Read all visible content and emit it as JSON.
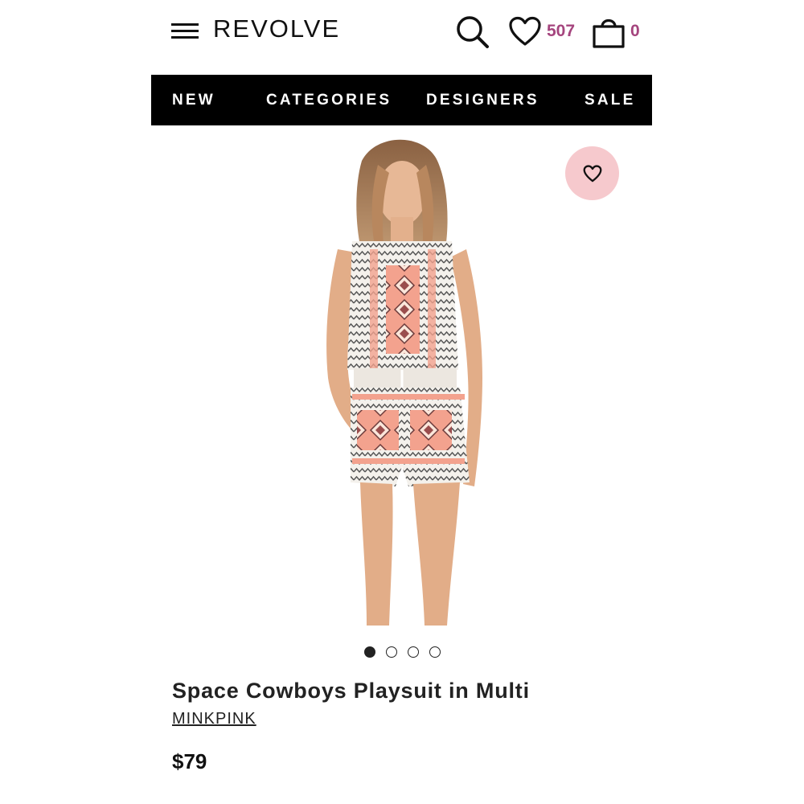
{
  "header": {
    "logo": "REVOLVE",
    "wishlist_count": "507",
    "bag_count": "0"
  },
  "nav": {
    "items": [
      "NEW",
      "CATEGORIES",
      "DESIGNERS",
      "SALE"
    ]
  },
  "product": {
    "title": "Space Cowboys Playsuit in Multi",
    "brand": "MINKPINK",
    "price": "$79",
    "image_count": 4,
    "active_image_index": 0
  },
  "colors": {
    "accent": "#a5457e",
    "nav_bg": "#000000",
    "fav_bg": "#f6c9cd"
  },
  "icons": {
    "menu": "hamburger-menu-icon",
    "search": "search-icon",
    "wishlist": "heart-icon",
    "bag": "shopping-bag-icon",
    "favorite": "heart-icon"
  }
}
